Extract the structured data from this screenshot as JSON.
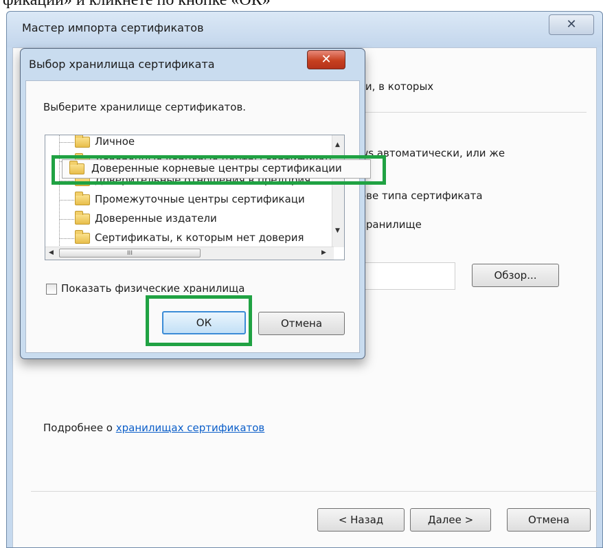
{
  "doc_caption": "фикации» и кликнете по кнопке «ОК»",
  "wizard": {
    "title": "Мастер импорта сертификатов",
    "close_glyph": "✕",
    "partial_text_1": "ги, в которых",
    "partial_text_2": "ws автоматически, или же",
    "partial_text_3": "ове типа сертификата",
    "partial_text_4": "хранилище",
    "browse_label": "Обзор...",
    "more_info_prefix": "Подробнее о ",
    "more_info_link": "хранилищах сертификатов",
    "back_label": "< Назад",
    "next_label": "Далее >",
    "cancel_label": "Отмена"
  },
  "dialog": {
    "title": "Выбор хранилища сертификата",
    "close_glyph": "✕",
    "prompt": "Выберите хранилище сертификатов.",
    "stores": [
      "Личное",
      "Доверенные корневые центры сертификации",
      "Доверительные отношения в предприя",
      "Промежуточные центры сертификаци",
      "Доверенные издатели",
      "Сертификаты, к которым нет доверия"
    ],
    "highlighted_store": "Доверенные корневые центры сертификации",
    "scroll_thumb_glyph": "III",
    "show_physical_label": "Показать физические хранилища",
    "show_physical_checked": false,
    "ok_label": "ОК",
    "cancel_label": "Отмена"
  },
  "colors": {
    "annotation_green": "#20a243",
    "link_blue": "#0b5ec9",
    "close_red": "#c6401f"
  }
}
